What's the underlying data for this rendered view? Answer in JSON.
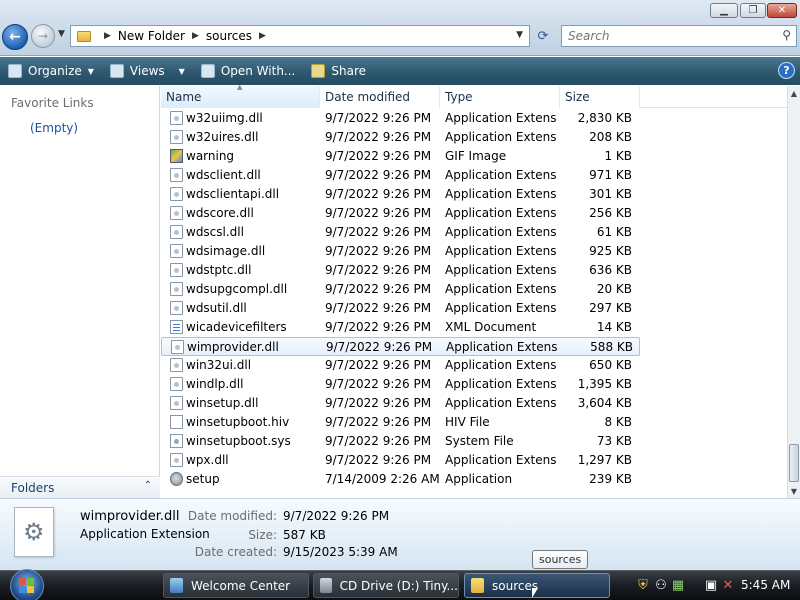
{
  "window": {
    "minimize_icon": "minimize-icon",
    "maximize_icon": "maximize-icon",
    "close_icon": "close-icon"
  },
  "address_bar": {
    "crumbs": [
      "New Folder",
      "sources"
    ]
  },
  "search": {
    "placeholder": "Search"
  },
  "toolbar": {
    "organize": "Organize",
    "views": "Views",
    "open_with": "Open With...",
    "share": "Share"
  },
  "nav_pane": {
    "favorite_links_title": "Favorite Links",
    "favorite_links_empty": "(Empty)",
    "folders_label": "Folders"
  },
  "columns": {
    "name": "Name",
    "date": "Date modified",
    "type": "Type",
    "size": "Size"
  },
  "files": [
    {
      "name": "w32uiimg.dll",
      "date": "9/7/2022 9:26 PM",
      "type": "Application Extens...",
      "size": "2,830 KB",
      "icon": "dll"
    },
    {
      "name": "w32uires.dll",
      "date": "9/7/2022 9:26 PM",
      "type": "Application Extens...",
      "size": "208 KB",
      "icon": "dll"
    },
    {
      "name": "warning",
      "date": "9/7/2022 9:26 PM",
      "type": "GIF Image",
      "size": "1 KB",
      "icon": "gif"
    },
    {
      "name": "wdsclient.dll",
      "date": "9/7/2022 9:26 PM",
      "type": "Application Extens...",
      "size": "971 KB",
      "icon": "dll"
    },
    {
      "name": "wdsclientapi.dll",
      "date": "9/7/2022 9:26 PM",
      "type": "Application Extens...",
      "size": "301 KB",
      "icon": "dll"
    },
    {
      "name": "wdscore.dll",
      "date": "9/7/2022 9:26 PM",
      "type": "Application Extens...",
      "size": "256 KB",
      "icon": "dll"
    },
    {
      "name": "wdscsl.dll",
      "date": "9/7/2022 9:26 PM",
      "type": "Application Extens...",
      "size": "61 KB",
      "icon": "dll"
    },
    {
      "name": "wdsimage.dll",
      "date": "9/7/2022 9:26 PM",
      "type": "Application Extens...",
      "size": "925 KB",
      "icon": "dll"
    },
    {
      "name": "wdstptc.dll",
      "date": "9/7/2022 9:26 PM",
      "type": "Application Extens...",
      "size": "636 KB",
      "icon": "dll"
    },
    {
      "name": "wdsupgcompl.dll",
      "date": "9/7/2022 9:26 PM",
      "type": "Application Extens...",
      "size": "20 KB",
      "icon": "dll"
    },
    {
      "name": "wdsutil.dll",
      "date": "9/7/2022 9:26 PM",
      "type": "Application Extens...",
      "size": "297 KB",
      "icon": "dll"
    },
    {
      "name": "wicadevicefilters",
      "date": "9/7/2022 9:26 PM",
      "type": "XML Document",
      "size": "14 KB",
      "icon": "xml"
    },
    {
      "name": "wimprovider.dll",
      "date": "9/7/2022 9:26 PM",
      "type": "Application Extens...",
      "size": "588 KB",
      "icon": "dll",
      "selected": true
    },
    {
      "name": "win32ui.dll",
      "date": "9/7/2022 9:26 PM",
      "type": "Application Extens...",
      "size": "650 KB",
      "icon": "dll"
    },
    {
      "name": "windlp.dll",
      "date": "9/7/2022 9:26 PM",
      "type": "Application Extens...",
      "size": "1,395 KB",
      "icon": "dll"
    },
    {
      "name": "winsetup.dll",
      "date": "9/7/2022 9:26 PM",
      "type": "Application Extens...",
      "size": "3,604 KB",
      "icon": "dll"
    },
    {
      "name": "winsetupboot.hiv",
      "date": "9/7/2022 9:26 PM",
      "type": "HIV File",
      "size": "8 KB",
      "icon": "blank"
    },
    {
      "name": "winsetupboot.sys",
      "date": "9/7/2022 9:26 PM",
      "type": "System File",
      "size": "73 KB",
      "icon": "sys"
    },
    {
      "name": "wpx.dll",
      "date": "9/7/2022 9:26 PM",
      "type": "Application Extens...",
      "size": "1,297 KB",
      "icon": "dll"
    },
    {
      "name": "setup",
      "date": "7/14/2009 2:26 AM",
      "type": "Application",
      "size": "239 KB",
      "icon": "app"
    }
  ],
  "details_pane": {
    "name": "wimprovider.dll",
    "type": "Application Extension",
    "date_modified_label": "Date modified:",
    "date_modified": "9/7/2022 9:26 PM",
    "size_label": "Size:",
    "size": "587 KB",
    "date_created_label": "Date created:",
    "date_created": "9/15/2023 5:39 AM"
  },
  "taskbar": {
    "buttons": [
      {
        "label": "Welcome Center",
        "icon": "welcome-center-icon"
      },
      {
        "label": "CD Drive (D:) Tiny...",
        "icon": "cd-drive-icon"
      },
      {
        "label": "sources",
        "icon": "folder-icon",
        "active": true
      }
    ],
    "tooltip": "sources",
    "clock": "5:45 AM"
  },
  "colors": {
    "command_bar": "#2f5a72",
    "selection_border": "#9fc4e8",
    "link_blue": "#1e50a0"
  }
}
